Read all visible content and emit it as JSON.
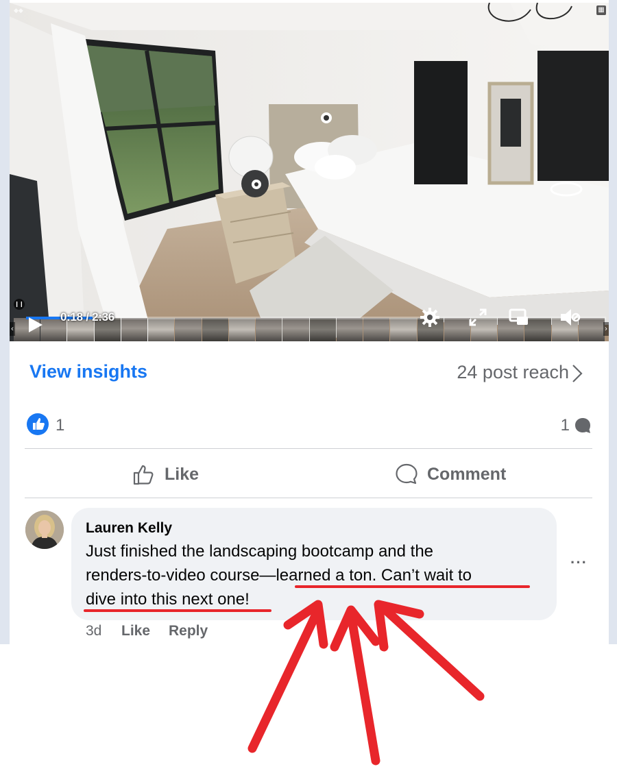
{
  "video": {
    "time": "0:18 / 2:36",
    "progress": 0.115
  },
  "insights": {
    "link": "View insights",
    "reach": "24 post reach"
  },
  "reactions": {
    "likes": "1",
    "comments": "1"
  },
  "actions": {
    "like": "Like",
    "comment": "Comment"
  },
  "comment": {
    "author": "Lauren Kelly",
    "line1": "Just finished the landscaping bootcamp and the",
    "line2_plain": "renders-to-video course—",
    "line2_highlight": "learned a ton. Can’t wait to",
    "line3_highlight": "dive into this next one!",
    "more": "···",
    "age": "3d",
    "like": "Like",
    "reply": "Reply"
  },
  "colors": {
    "accent": "#1877f2",
    "annotation": "#e8262b",
    "muted": "#65676b",
    "bubble": "#f0f2f5"
  }
}
